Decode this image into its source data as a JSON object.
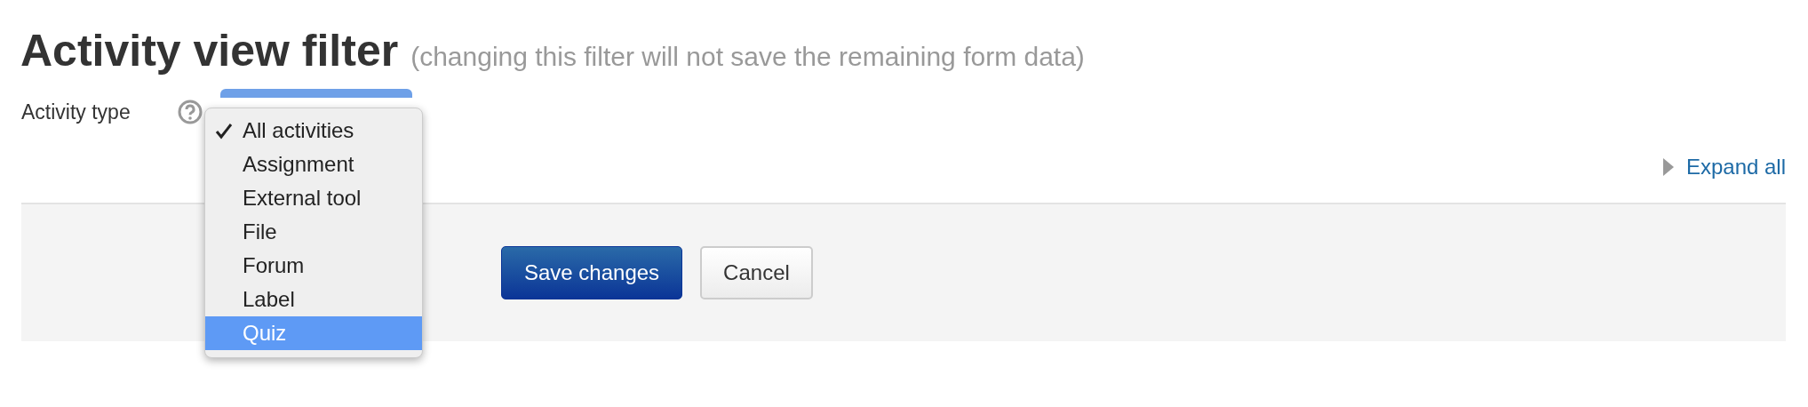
{
  "heading": {
    "title": "Activity view filter",
    "note": "(changing this filter will not save the remaining form data)"
  },
  "filter": {
    "label": "Activity type",
    "options": [
      {
        "label": "All activities",
        "checked": true,
        "selected": false
      },
      {
        "label": "Assignment",
        "checked": false,
        "selected": false
      },
      {
        "label": "External tool",
        "checked": false,
        "selected": false
      },
      {
        "label": "File",
        "checked": false,
        "selected": false
      },
      {
        "label": "Forum",
        "checked": false,
        "selected": false
      },
      {
        "label": "Label",
        "checked": false,
        "selected": false
      },
      {
        "label": "Quiz",
        "checked": false,
        "selected": true
      }
    ]
  },
  "expand_link": "Expand all",
  "buttons": [
    {
      "label": "Save changes",
      "kind": "primary"
    },
    {
      "label": "Cancel",
      "kind": "secondary"
    }
  ]
}
